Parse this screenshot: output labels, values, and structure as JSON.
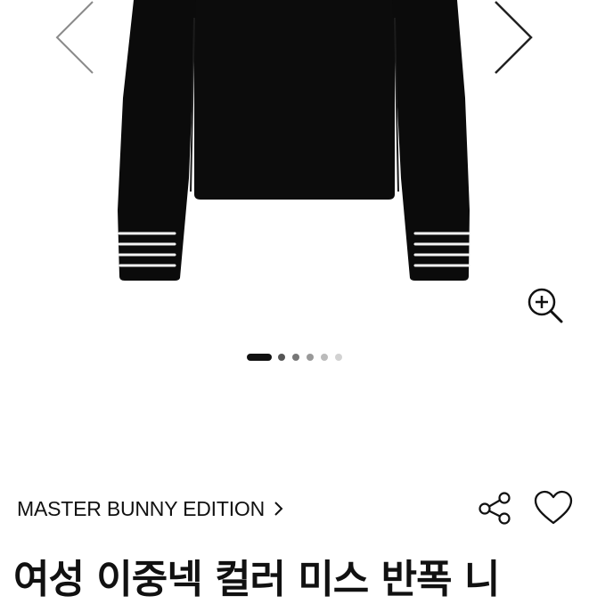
{
  "gallery": {
    "image": "black-knit-sweater-with-white-striped-cuffs",
    "slide_count": 6,
    "active_slide": 1,
    "colors": {
      "garment": "#0c0c0c",
      "stripe": "#f4f4f4"
    }
  },
  "icons": {
    "prev": "chevron-left-icon",
    "next": "chevron-right-icon",
    "zoom": "zoom-in-icon",
    "share": "share-icon",
    "like": "heart-icon"
  },
  "product": {
    "brand": "MASTER BUNNY EDITION",
    "title": "여성 이중넥 컬러 미스 반폭 니"
  }
}
